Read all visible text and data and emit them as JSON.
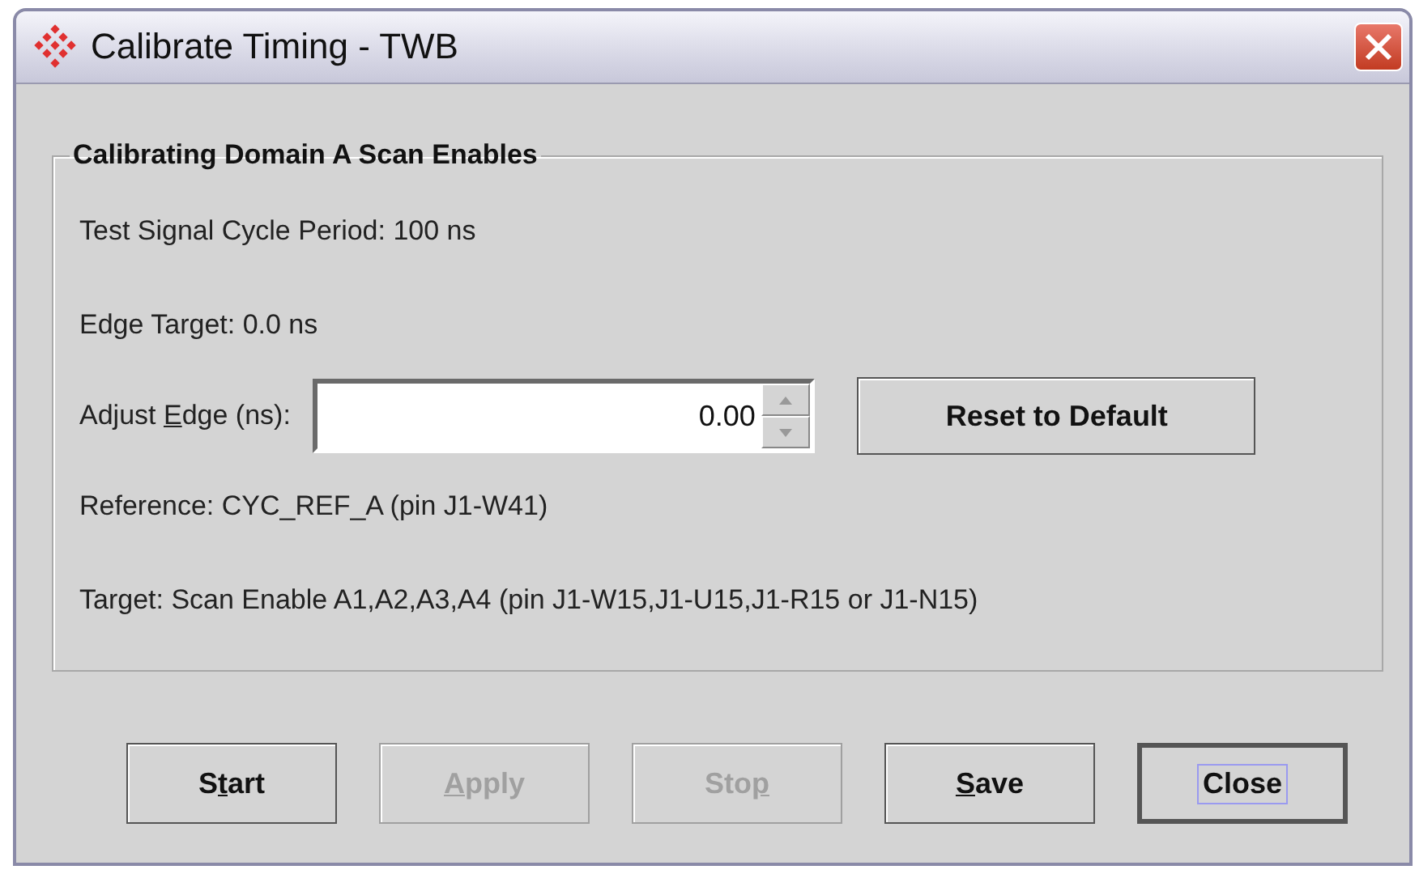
{
  "window": {
    "title": "Calibrate Timing - TWB"
  },
  "group": {
    "title": "Calibrating Domain A Scan Enables",
    "period": "Test Signal Cycle Period:  100 ns",
    "edge_target": "Edge Target:  0.0 ns",
    "adjust": {
      "label": {
        "pre": "Adjust ",
        "key": "E",
        "post": "dge (ns):"
      },
      "value": "0.00"
    },
    "reset_button": {
      "label": "Reset to Default",
      "disabled": false
    },
    "reference": "Reference: CYC_REF_A (pin J1-W41)",
    "target": "Target: Scan Enable A1,A2,A3,A4 (pin J1-W15,J1-U15,J1-R15 or J1-N15)"
  },
  "buttons": [
    {
      "label": {
        "pre": "S",
        "key": "t",
        "post": "art"
      },
      "disabled": false,
      "focused": false
    },
    {
      "label": {
        "key": "A",
        "post": "pply"
      },
      "disabled": true,
      "focused": false
    },
    {
      "label": {
        "pre": "Sto",
        "key": "p"
      },
      "disabled": true,
      "focused": false
    },
    {
      "label": {
        "key": "S",
        "post": "ave"
      },
      "disabled": false,
      "focused": false
    },
    {
      "label": {
        "pre": "Close"
      },
      "disabled": false,
      "focused": true
    }
  ]
}
